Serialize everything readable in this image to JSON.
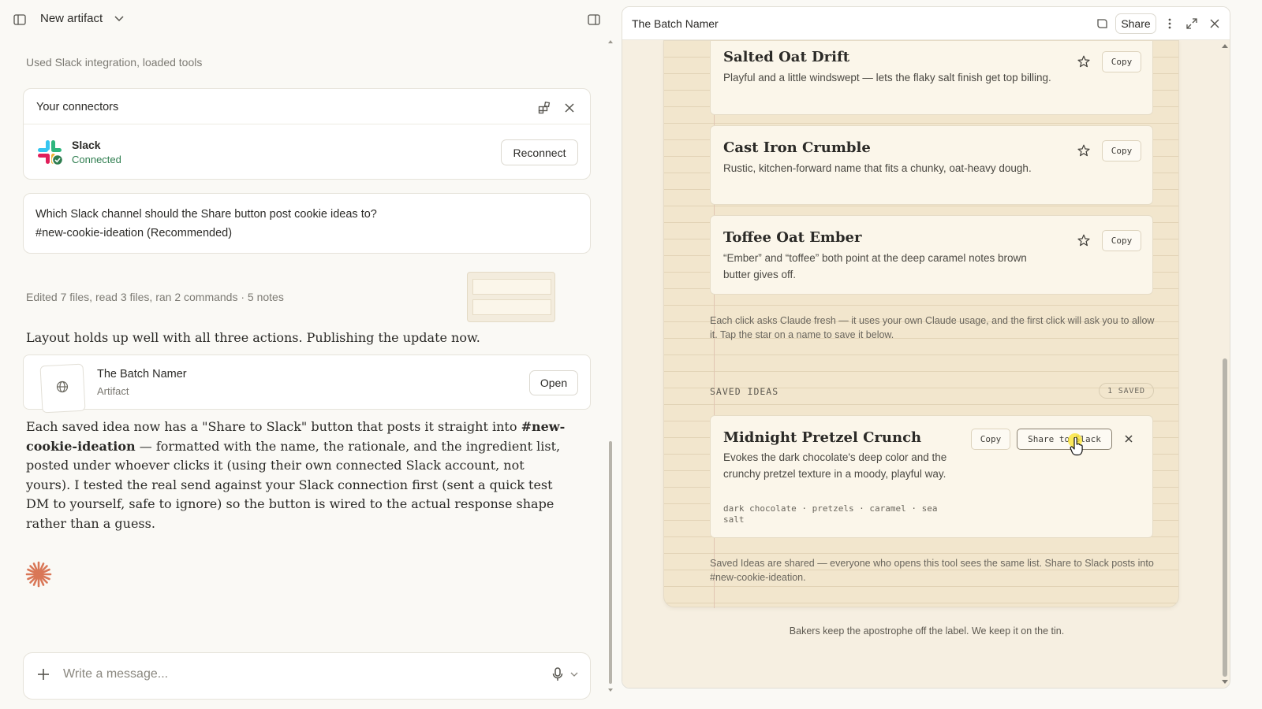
{
  "left": {
    "topbar": {
      "title": "New artifact"
    },
    "tool_status": "Used Slack integration, loaded tools",
    "connectors": {
      "title": "Your connectors",
      "slack_name": "Slack",
      "slack_status": "Connected",
      "reconnect_label": "Reconnect"
    },
    "question": {
      "text": "Which Slack channel should the Share button post cookie ideas to?",
      "answer": "#new-cookie-ideation (Recommended)"
    },
    "edit_summary": "Edited 7 files, read 3 files, ran 2 commands · 5 notes",
    "message1": "Layout holds up well with all three actions. Publishing the update now.",
    "artifact_card": {
      "name": "The Batch Namer",
      "type": "Artifact",
      "open_label": "Open"
    },
    "message2": {
      "part1": "Each saved idea now has a \"Share to Slack\" button that posts it straight into ",
      "channel": "#new-cookie-ideation",
      "part2": " — formatted with the name, the rationale, and the ingredient list, posted under whoever clicks it (using their own connected Slack account, not yours). I tested the real send against your Slack connection first (sent a quick test DM to yourself, safe to ignore) so the button is wired to the actual response shape rather than a guess."
    },
    "composer": {
      "placeholder": "Write a message..."
    }
  },
  "right": {
    "header": {
      "title": "The Batch Namer",
      "share_label": "Share"
    },
    "ideas": [
      {
        "name": "Salted Oat Drift",
        "desc": "Playful and a little windswept — lets the flaky salt finish get top billing.",
        "copy_label": "Copy"
      },
      {
        "name": "Cast Iron Crumble",
        "desc": "Rustic, kitchen-forward name that fits a chunky, oat-heavy dough.",
        "copy_label": "Copy"
      },
      {
        "name": "Toffee Oat Ember",
        "desc": "“Ember” and “toffee” both point at the deep caramel notes brown butter gives off.",
        "copy_label": "Copy"
      }
    ],
    "usage_note": "Each click asks Claude fresh — it uses your own Claude usage, and the first click will ask you to allow it. Tap the star on a name to save it below.",
    "saved_heading": "SAVED IDEAS",
    "saved_count": "1 SAVED",
    "saved_idea": {
      "name": "Midnight Pretzel Crunch",
      "desc": "Evokes the dark chocolate's deep color and the crunchy pretzel texture in a moody, playful way.",
      "ingredients": "dark chocolate · pretzels · caramel · sea salt",
      "copy_label": "Copy",
      "share_label": "Share to Slack"
    },
    "shared_note": "Saved Ideas are shared — everyone who opens this tool sees the same list. Share to Slack posts into #new-cookie-ideation.",
    "footer": "Bakers keep the apostrophe off the label. We keep it on the tin."
  },
  "colors": {
    "slack_connected": "#2e7d4f",
    "paper": "#f2e6cd",
    "claude_accent": "#d97757"
  }
}
